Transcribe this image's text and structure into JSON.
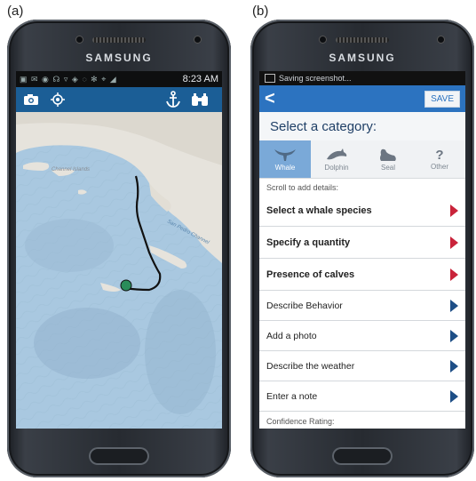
{
  "labels": {
    "a": "(a)",
    "b": "(b)"
  },
  "phone_a": {
    "brand": "SAMSUNG",
    "status": {
      "icons": "▣ ✉ ◉ ☊ ▿ ◈   ◌ ✻ ⌖ ◢",
      "time": "8:23 AM"
    },
    "toolbar_icons": [
      "camera-icon",
      "locate-icon",
      "anchor-icon",
      "binoculars-icon"
    ],
    "map": {
      "label_islands": "Channel Islands",
      "label_sanpedro": "San Pedro Channel"
    }
  },
  "phone_b": {
    "brand": "SAMSUNG",
    "status": {
      "text": "Saving screenshot..."
    },
    "header": {
      "back": "<",
      "save": "SAVE"
    },
    "category_title": "Select a category:",
    "categories": [
      {
        "label": "Whale",
        "selected": true
      },
      {
        "label": "Dolphin",
        "selected": false
      },
      {
        "label": "Seal",
        "selected": false
      },
      {
        "label": "Other",
        "selected": false
      }
    ],
    "scroll_note": "Scroll to add details:",
    "rows": [
      {
        "label": "Select a whale species",
        "required": true
      },
      {
        "label": "Specify a quantity",
        "required": true
      },
      {
        "label": "Presence of calves",
        "required": true
      },
      {
        "label": "Describe Behavior",
        "required": false
      },
      {
        "label": "Add a photo",
        "required": false
      },
      {
        "label": "Describe the weather",
        "required": false
      },
      {
        "label": "Enter a note",
        "required": false
      }
    ],
    "confidence": "Confidence Rating:"
  }
}
